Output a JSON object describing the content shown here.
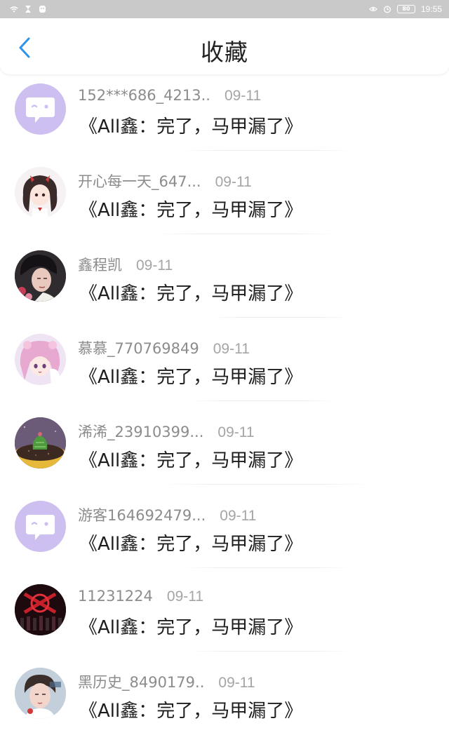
{
  "status_bar": {
    "battery": "80",
    "time": "19:55"
  },
  "header": {
    "title": "收藏"
  },
  "items": [
    {
      "username": "152***686_4213..",
      "date": "09-11",
      "title": "《All鑫：完了，马甲漏了》",
      "avatar": "default-chat-bubble-avatar"
    },
    {
      "username": "开心每一天_647...",
      "date": "09-11",
      "title": "《All鑫：完了，马甲漏了》",
      "avatar": "anime-girl-avatar"
    },
    {
      "username": "鑫程凯",
      "date": "09-11",
      "title": "《All鑫：完了，马甲漏了》",
      "avatar": "portrait-photo-avatar"
    },
    {
      "username": "慕慕_770769849",
      "date": "09-11",
      "title": "《All鑫：完了，马甲漏了》",
      "avatar": "anime-pink-hair-avatar"
    },
    {
      "username": "浠浠_23910399...",
      "date": "09-11",
      "title": "《All鑫：完了，马甲漏了》",
      "avatar": "cactus-plant-avatar"
    },
    {
      "username": "游客164692479...",
      "date": "09-11",
      "title": "《All鑫：完了，马甲漏了》",
      "avatar": "default-chat-bubble-avatar"
    },
    {
      "username": "11231224",
      "date": "09-11",
      "title": "《All鑫：完了，马甲漏了》",
      "avatar": "stage-group-photo-avatar"
    },
    {
      "username": "黑历史_8490179..",
      "date": "09-11",
      "title": "《All鑫：完了，马甲漏了》",
      "avatar": "portrait-boy-avatar"
    }
  ],
  "colors": {
    "accent": "#2f93e8",
    "default_avatar": "#cdbff0"
  }
}
